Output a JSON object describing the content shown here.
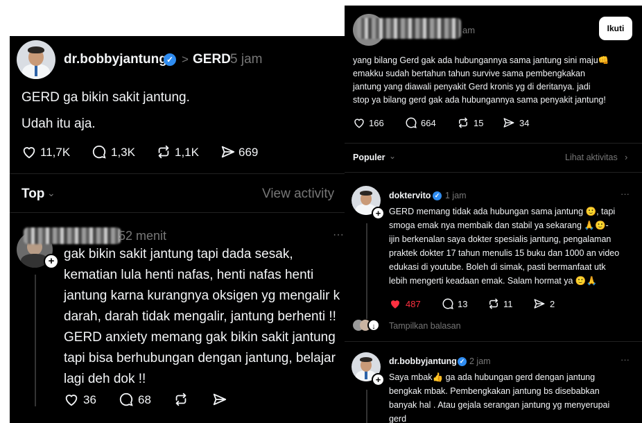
{
  "colors": {
    "background": "#000000",
    "text": "#f3f5f7",
    "muted": "#777777",
    "verified": "#2f8cf0",
    "like_active": "#ff3040",
    "button_bg": "#ffffff"
  },
  "left": {
    "post": {
      "username": "dr.bobbyjantung",
      "arrow": ">",
      "topic": "GERD",
      "time": "5 jam",
      "line1": "GERD ga bikin sakit jantung.",
      "line2": "Udah itu aja.",
      "likes": "11,7K",
      "replies": "1,3K",
      "reposts": "1,1K",
      "shares": "669"
    },
    "section": {
      "label": "Top",
      "activity": "View activity"
    },
    "reply": {
      "time": "52 menit",
      "more": "···",
      "lines": [
        "gak bikin sakit jantung tapi dada sesak,",
        "kematian lula henti nafas, henti nafas henti",
        "jantung karna kurangnya oksigen yg mengalir k",
        "darah, darah tidak mengalir, jantung berhenti !!",
        "GERD anxiety memang gak bikin sakit jantung",
        "tapi bisa berhubungan dengan jantung, belajar",
        "lagi deh dok !!"
      ],
      "likes": "36",
      "replies": "68"
    }
  },
  "right": {
    "post": {
      "time": "am",
      "follow": "Ikuti",
      "lines": [
        "yang bilang Gerd gak ada hubungannya sama jantung sini maju👊",
        "emakku sudah bertahun tahun survive sama pembengkakan",
        "jantung yang diawali penyakit Gerd kronis yg di deritanya. jadi",
        "stop ya bilang gerd gak ada hubungannya sama penyakit jantung!"
      ],
      "likes": "166",
      "replies": "664",
      "reposts": "15",
      "shares": "34"
    },
    "section": {
      "label": "Populer",
      "activity": "Lihat aktivitas"
    },
    "reply1": {
      "username": "doktervito",
      "time": "1 jam",
      "more": "···",
      "lines": [
        "GERD memang tidak ada hubungan sama jantung 🙂, tapi",
        "smoga emak nya membaik dan stabil ya sekarang 🙏🙂-",
        "ijin berkenalan saya dokter spesialis jantung, pengalaman",
        "praktek dokter 17 tahun menulis 15 buku dan 1000 an video",
        "edukasi di youtube. Boleh di simak, pasti bermanfaat utk",
        "lebih mengerti keadaan emak. Salam hormat ya 🙂🙏"
      ],
      "likes": "487",
      "replies": "13",
      "reposts": "11",
      "shares": "2",
      "show_replies": "Tampilkan balasan"
    },
    "reply2": {
      "username": "dr.bobbyjantung",
      "time": "2 jam",
      "more": "···",
      "lines": [
        "Saya mbak👍 ga ada hubungan gerd dengan jantung",
        "bengkak mbak.  Pembengkakan jantung bs disebabkan",
        "banyak hal . Atau gejala serangan jantung yg menyerupai",
        "gerd"
      ]
    }
  }
}
